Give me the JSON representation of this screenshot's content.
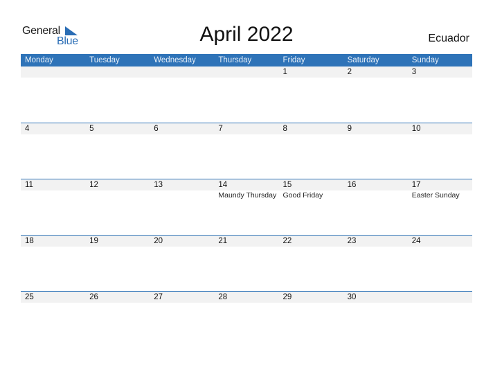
{
  "logo": {
    "general": "General",
    "blue": "Blue"
  },
  "title": "April 2022",
  "country": "Ecuador",
  "colors": {
    "accent": "#2e73b8",
    "strip": "#f2f2f2"
  },
  "weekdays": [
    "Monday",
    "Tuesday",
    "Wednesday",
    "Thursday",
    "Friday",
    "Saturday",
    "Sunday"
  ],
  "weeks": [
    {
      "days": [
        "",
        "",
        "",
        "",
        "1",
        "2",
        "3"
      ],
      "events": [
        "",
        "",
        "",
        "",
        "",
        "",
        ""
      ]
    },
    {
      "days": [
        "4",
        "5",
        "6",
        "7",
        "8",
        "9",
        "10"
      ],
      "events": [
        "",
        "",
        "",
        "",
        "",
        "",
        ""
      ]
    },
    {
      "days": [
        "11",
        "12",
        "13",
        "14",
        "15",
        "16",
        "17"
      ],
      "events": [
        "",
        "",
        "",
        "Maundy Thursday",
        "Good Friday",
        "",
        "Easter Sunday"
      ]
    },
    {
      "days": [
        "18",
        "19",
        "20",
        "21",
        "22",
        "23",
        "24"
      ],
      "events": [
        "",
        "",
        "",
        "",
        "",
        "",
        ""
      ]
    },
    {
      "days": [
        "25",
        "26",
        "27",
        "28",
        "29",
        "30",
        ""
      ],
      "events": [
        "",
        "",
        "",
        "",
        "",
        "",
        ""
      ]
    }
  ]
}
